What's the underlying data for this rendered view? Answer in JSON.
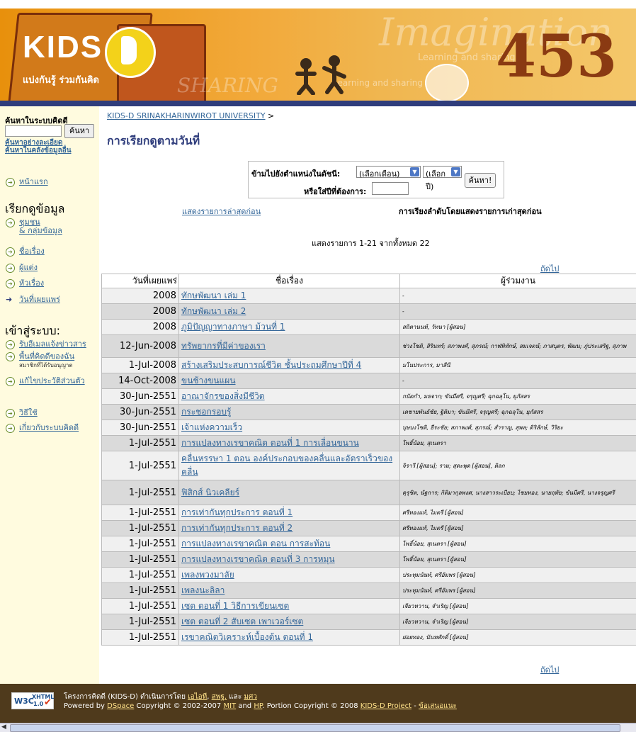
{
  "banner": {
    "logo_text": "KIDS",
    "logo_letter": "D",
    "tagline": "แบ่งกันรู้ ร่วมกันคิด",
    "decor_imagination": "Imagination",
    "decor_learning": "Learning and sharing",
    "decor_learning2": "Learning and sharing",
    "decor_digits": "453",
    "decor_share": "SHARING"
  },
  "sidebar": {
    "search_title": "ค้นหาในระบบคิดดี",
    "search_button": "ค้นหา",
    "advanced_search": "ค้นหาอย่างละเอียด",
    "search_archive": "ค้นหาในคลังข้อมูลอื่น",
    "home": "หน้าแรก",
    "browse_title": "เรียกดูข้อมูล",
    "browse": {
      "communities_1": "ชุมชน",
      "communities_2": "& กลุ่มข้อมูล",
      "titles": "ชื่อเรื่อง",
      "authors": "ผู้แต่ง",
      "subjects": "หัวเรื่อง",
      "dates": "วันที่เผยแพร่"
    },
    "login_title": "เข้าสู่ระบบ:",
    "login": {
      "alerts": "รับอีเมลแจ้งข่าวสาร",
      "my_space": "พื้นที่คิดดีของฉัน",
      "members_only": "สมาชิกที่ได้รับอนุญาต",
      "profile": "แก้ไขประวัติส่วนตัว"
    },
    "help": "วิธีใช้",
    "about": "เกี่ยวกับระบบคิดดี"
  },
  "main": {
    "breadcrumb": "KIDS-D SRINAKHARINWIROT UNIVERSITY",
    "breadcrumb_sep": ">",
    "page_title": "การเรียกดูตามวันที่",
    "jump_label": "ข้ามไปยังตำแหน่งในดัชนี:",
    "month_select": "(เลือกเดือน)",
    "year_select": "(เลือกปี)",
    "go_button": "ค้นหา!",
    "year_label": "หรือใส่ปีที่ต้องการ:",
    "latest_first": "แสดงรายการล่าสุดก่อน",
    "sort_info": "การเรียงลำดับโดยแสดงรายการเก่าสุดก่อน",
    "showing": "แสดงรายการ 1-21 จากทั้งหมด 22",
    "next": "ถัดไป"
  },
  "table": {
    "headers": [
      "วันที่เผยแพร่",
      "ชื่อเรื่อง",
      "ผู้ร่วมงาน"
    ],
    "rows": [
      {
        "date": "2008",
        "title": "ทักษพัฒนา เล่ม 1",
        "contrib": "-"
      },
      {
        "date": "2008",
        "title": "ทักษพัฒนา เล่ม 2",
        "contrib": "-"
      },
      {
        "date": "2008",
        "title": "ภูมิปัญญาทางภาษา ม้วนที่ 1",
        "contrib": "สถิตานนท์, วัทนา [ผู้สอน]"
      },
      {
        "date": "12-Jun-2008",
        "title": "ทรัพยากรที่มีค่าของเรา",
        "contrib": "ช่วงโชติ, สิรินทร์; สภาพงศ์, สุภรณ์; กาฬพิทักษ์, สมเจตน์; ภาสบุตร, พัฒน; ภู่ประเสริฐ, สุภาพ"
      },
      {
        "date": "1-Jul-2008",
        "title": "สร้างเสริมประสบการณ์ชีวิต ชั้นประถมศึกษาปีที่ 4",
        "contrib": "มโนประการ, มาลีนี"
      },
      {
        "date": "14-Oct-2008",
        "title": "ขนช้างขนแผน",
        "contrib": "-"
      },
      {
        "date": "30-Jun-2551",
        "title": "อาณาจักรของสิ่งมีชีวิต",
        "contrib": "กนัดกำ, มธจาก; ขันมีศรี, จรุญศรี; ฉุกฉลุโน, ยุภัสสร"
      },
      {
        "date": "30-Jun-2551",
        "title": "กระชอกรอบรู้",
        "contrib": "เดชายพันธ์ชัย, ฐิติมา; ขันมีศรี, จรุญศรี; ฉุกฉลุโน, ยุภัสสร"
      },
      {
        "date": "30-Jun-2551",
        "title": "เจ้าแห่งความเร็ว",
        "contrib": "บุษบงโชติ, ธีระชัย; สภาพงศ์, สุภรณ์; สำราญ, สุพล; ดิริลักษ์, วิริยะ"
      },
      {
        "date": "1-Jul-2551",
        "title": "การแปลงทางเรขาคณิต ตอนที่ 1 การเลื่อนขนาน",
        "contrib": "โพธิ์น้อย, สุเนตรา"
      },
      {
        "date": "1-Jul-2551",
        "title": "คลื่นหรรษา 1 ตอน องค์ประกอบของคลื่นและอัตราเร็วของคลื่น",
        "contrib": "จิราวี [ผู้สอน]; ราม; สุดะพุด [ผู้สอน], ติลก"
      },
      {
        "date": "1-Jul-2551",
        "title": "ฟิสิกส์ นิวเคลียร์",
        "contrib": "คุรุชิต, นัฐการ; กิติมากุลพงศ, นางสาวระเบียบ; ไชยทอง, นายฤทัย; ขันมีศรี, นางจรุญศรี"
      },
      {
        "date": "1-Jul-2551",
        "title": "การเท่ากันทุกประการ ตอนที่ 1",
        "contrib": "ศรีทองแท้, ไมตรี [ผู้สอน]"
      },
      {
        "date": "1-Jul-2551",
        "title": "การเท่ากันทุกประการ ตอนที่ 2",
        "contrib": "ศรีทองแท้, ไมตรี [ผู้สอน]"
      },
      {
        "date": "1-Jul-2551",
        "title": "การแปลงทางเรขาคณิต ตอน การสะท้อน",
        "contrib": "โพธิ์น้อย, สุเนตรา [ผู้สอน]"
      },
      {
        "date": "1-Jul-2551",
        "title": "การแปลงทางเรขาคณิต ตอนที่ 3 การหมุน",
        "contrib": "โพธิ์น้อย, สุเนตรา [ผู้สอน]"
      },
      {
        "date": "1-Jul-2551",
        "title": "เพลงพวงมาลัย",
        "contrib": "ประทุมนันท์, ศรีอัมพร [ผู้สอน]"
      },
      {
        "date": "1-Jul-2551",
        "title": "เพลงนะลิลา",
        "contrib": "ประทุมนันท์, ศรีอัมพร [ผู้สอน]"
      },
      {
        "date": "1-Jul-2551",
        "title": "เซต ตอนที่ 1 วิธีการเขียนเซต",
        "contrib": "เจียวหวาน, จำเริญ [ผู้สอน]"
      },
      {
        "date": "1-Jul-2551",
        "title": "เซต ตอนที่ 2 สับเซต เพาเวอร์เซต",
        "contrib": "เจียวหวาน, จำเริญ [ผู้สอน]"
      },
      {
        "date": "1-Jul-2551",
        "title": "เรขาคณิตวิเคราะห์เบื้องต้น ตอนที่ 1",
        "contrib": "ฝอยทอง, นันทศักดิ์ [ผู้สอน]"
      }
    ]
  },
  "footer": {
    "badge_w3c": "W3C",
    "badge_xhtml": "XHTML",
    "badge_ver": "1.0",
    "line1_prefix": "โครงการคิดดี (KIDS-D) ดำเนินการโดย",
    "line1_link1": "เอไอที",
    "line1_sep1": ",",
    "line1_link2": "สพฐ.",
    "line1_sep2": " และ",
    "line1_link3": "มศว",
    "line2_prefix": "Powered by",
    "line2_link1": "DSpace",
    "line2_mid1": "Copyright © 2002-2007",
    "line2_link2": "MIT",
    "line2_mid2": "and",
    "line2_link3": "HP",
    "line2_mid3": ". Portion Copyright © 2008",
    "line2_link4": "KIDS-D Project",
    "line2_dash": "-",
    "line2_link5": "ข้อเสนอแนะ"
  },
  "colors": {
    "banner_orange": "#e8900c",
    "nav_blue": "#2f3d7c",
    "link": "#336699",
    "sidebar_bg": "#fffbdf",
    "footer_bg": "#4f3a1c"
  }
}
